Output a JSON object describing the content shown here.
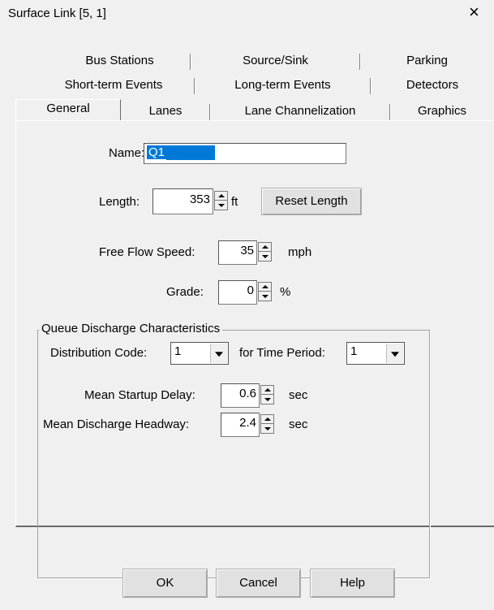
{
  "window": {
    "title": "Surface Link [5, 1]",
    "close_glyph": "×",
    "close_icon": "close-icon"
  },
  "tabs": {
    "row1": [
      "Bus Stations",
      "Source/Sink",
      "Parking"
    ],
    "row2": [
      "Short-term Events",
      "Long-term Events",
      "Detectors"
    ],
    "row3": [
      "General",
      "Lanes",
      "Lane Channelization",
      "Graphics"
    ],
    "active": "General"
  },
  "general": {
    "name_label": "Name:",
    "name_value": "Q1",
    "length_label": "Length:",
    "length_value": "353",
    "length_unit": "ft",
    "reset_length_button": "Reset Length",
    "free_flow_speed_label": "Free Flow Speed:",
    "free_flow_speed_value": "35",
    "free_flow_speed_unit": "mph",
    "grade_label": "Grade:",
    "grade_value": "0",
    "grade_unit": "%"
  },
  "queue_discharge": {
    "group_title": "Queue Discharge Characteristics",
    "distribution_code_label": "Distribution Code:",
    "distribution_code_value": "1",
    "time_period_label": "for Time Period:",
    "time_period_value": "1",
    "startup_delay_label": "Mean Startup Delay:",
    "startup_delay_value": "0.6",
    "startup_delay_unit": "sec",
    "discharge_headway_label": "Mean Discharge Headway:",
    "discharge_headway_value": "2.4",
    "discharge_headway_unit": "sec"
  },
  "buttons": {
    "ok": "OK",
    "cancel": "Cancel",
    "help": "Help"
  },
  "colors": {
    "window_bg": "#f0f0f0",
    "selection": "#0078d7"
  }
}
